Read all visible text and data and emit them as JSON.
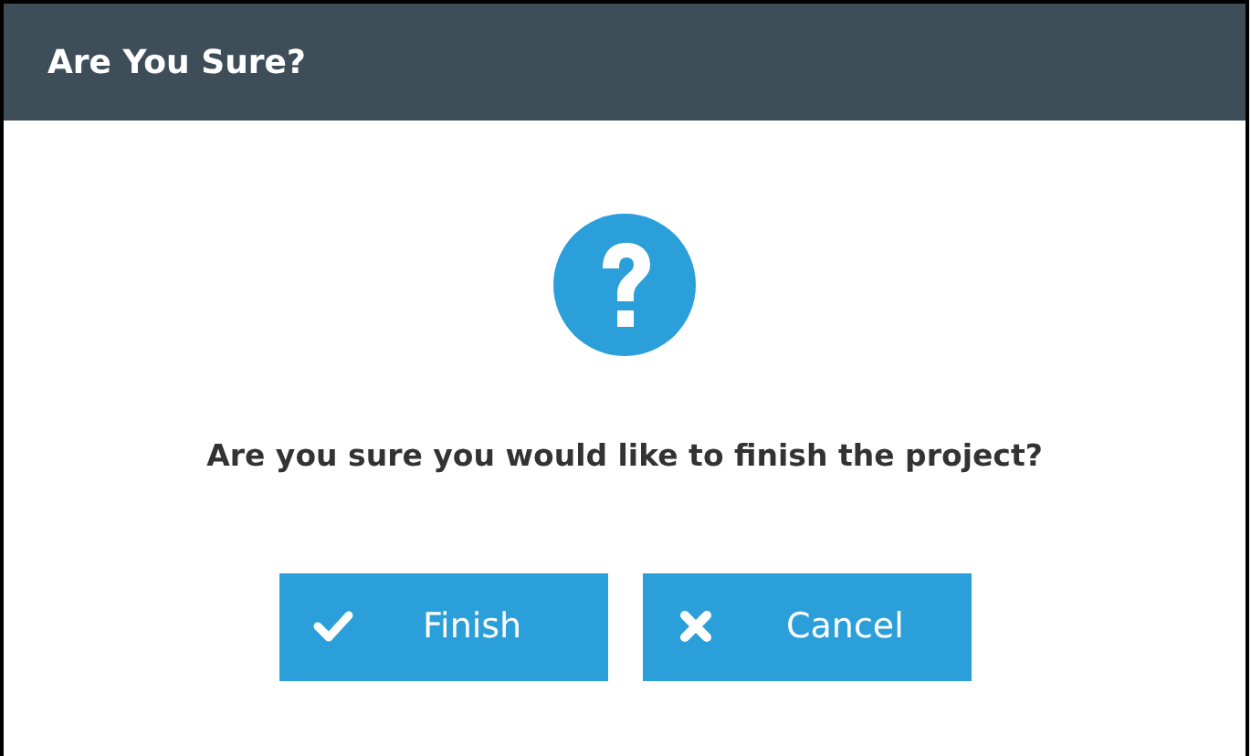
{
  "dialog": {
    "title": "Are You Sure?",
    "message": "Are you sure you would like to finish the project?",
    "buttons": [
      {
        "label": "Finish",
        "kind": "confirm"
      },
      {
        "label": "Cancel",
        "kind": "cancel"
      }
    ]
  }
}
